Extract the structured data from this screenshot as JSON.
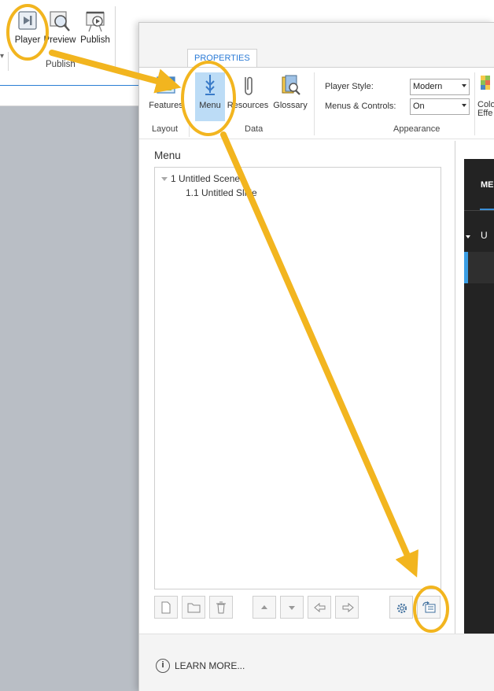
{
  "background_ribbon": {
    "buttons": [
      {
        "label": "Player",
        "icon": "player-icon"
      },
      {
        "label": "Preview",
        "icon": "preview-icon"
      },
      {
        "label": "Publish",
        "icon": "publish-icon"
      }
    ],
    "group_label": "Publish"
  },
  "dialog": {
    "tab": "PROPERTIES",
    "ribbon": {
      "buttons": [
        {
          "label": "Features",
          "icon": "features-icon"
        },
        {
          "label": "Menu",
          "icon": "menu-icon",
          "active": true
        },
        {
          "label": "Resources",
          "icon": "resources-icon"
        },
        {
          "label": "Glossary",
          "icon": "glossary-icon"
        },
        {
          "label": "Colo Effe",
          "icon": "colors-effects-icon"
        }
      ],
      "groups": [
        "Layout",
        "Data",
        "Appearance"
      ],
      "player_style_label": "Player Style:",
      "player_style_value": "Modern",
      "menus_controls_label": "Menus & Controls:",
      "menus_controls_value": "On"
    },
    "menu_title": "Menu",
    "tree": [
      {
        "label": "1 Untitled Scene",
        "level": 0
      },
      {
        "label": "1.1 Untitled Slide",
        "level": 1
      }
    ],
    "toolbar": [
      "new-page-icon",
      "open-folder-icon",
      "trash-icon",
      "move-up-icon",
      "move-down-icon",
      "outdent-icon",
      "indent-icon",
      "settings-gear-icon",
      "reset-menu-icon"
    ],
    "footer": {
      "learn_more": "LEARN MORE..."
    },
    "preview": {
      "tab": "ME",
      "row_letter": "U"
    }
  },
  "colors": {
    "annotation": "#f2b51f",
    "accent_blue": "#2b7bd6",
    "active_button": "#bcdcf6",
    "preview_bg": "#232323"
  }
}
